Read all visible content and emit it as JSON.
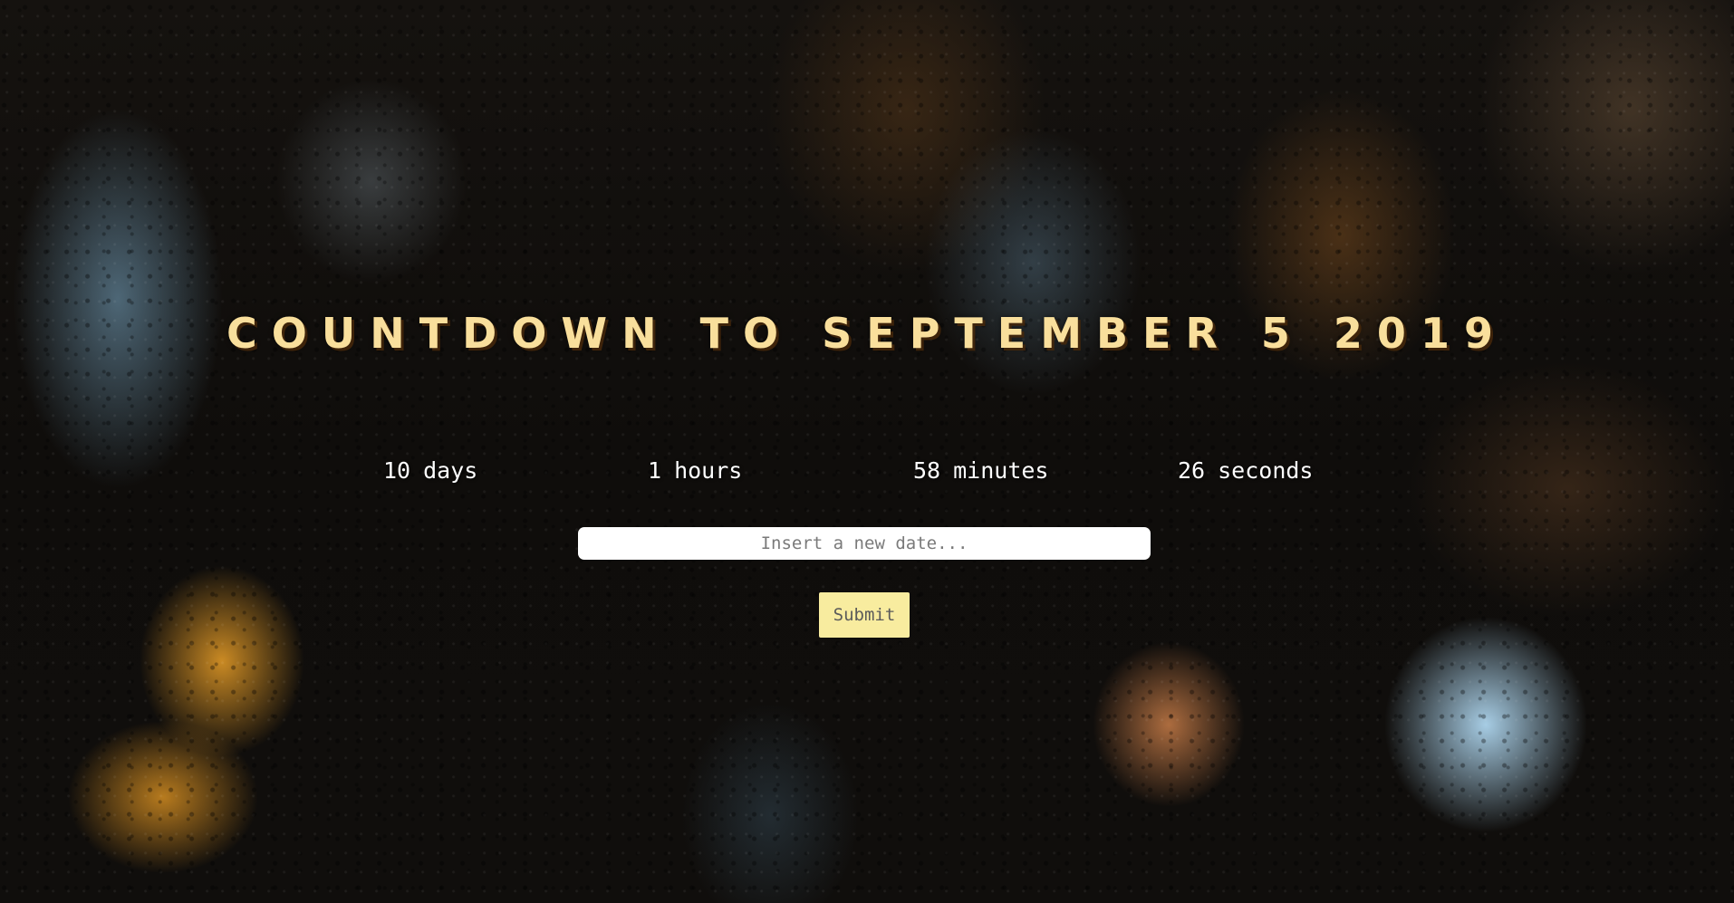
{
  "page": {
    "title": "Countdown to September 5 2019"
  },
  "countdown": {
    "days": {
      "value": "10",
      "label": "days"
    },
    "hours": {
      "value": "1",
      "label": "hours"
    },
    "minutes": {
      "value": "58",
      "label": "minutes"
    },
    "seconds": {
      "value": "26",
      "label": "seconds"
    }
  },
  "form": {
    "date_input": {
      "value": "",
      "placeholder": "Insert a new date..."
    },
    "submit_label": "Submit"
  },
  "colors": {
    "title": "#f9df9c",
    "submit_background": "#f8ec9f",
    "countdown_text": "#ffffff"
  }
}
